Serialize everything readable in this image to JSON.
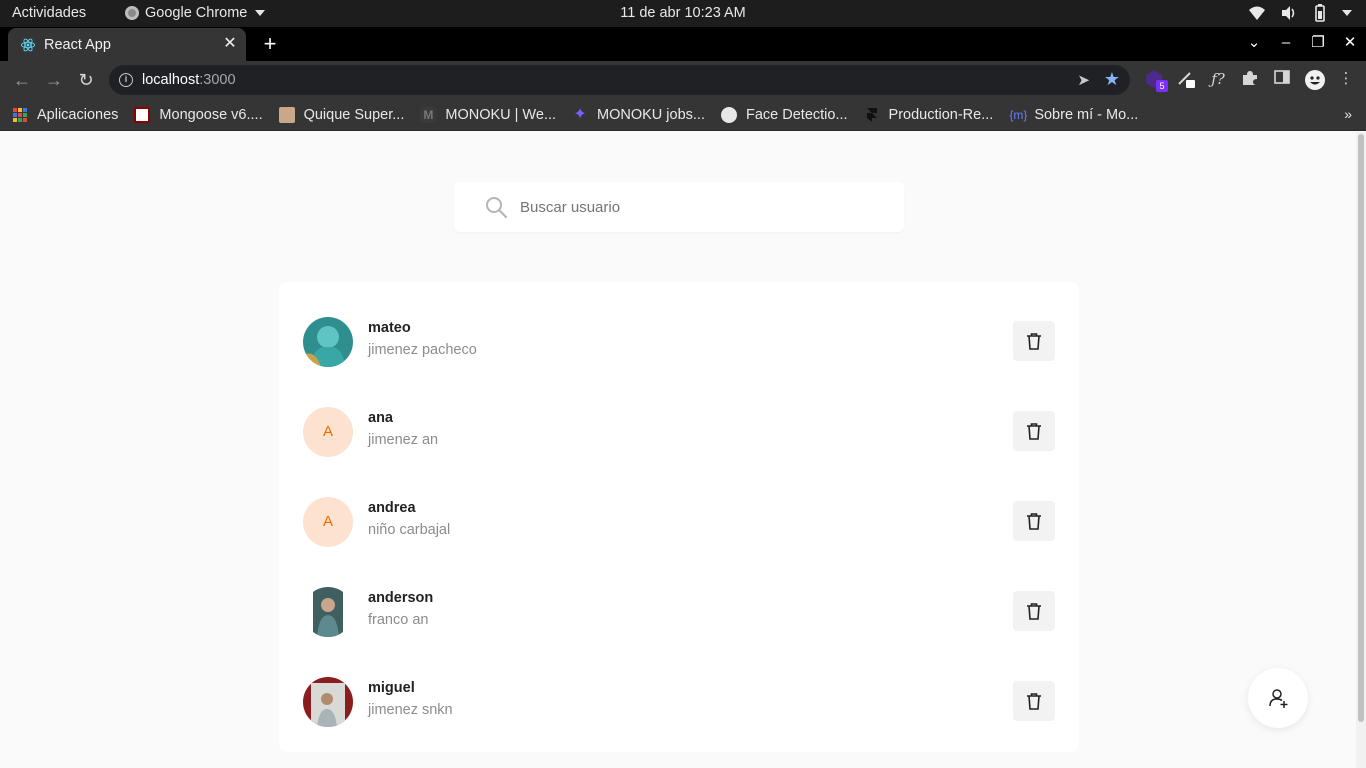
{
  "system_bar": {
    "activities": "Actividades",
    "app_name": "Google Chrome",
    "clock": "11 de abr  10:23 AM"
  },
  "browser": {
    "tab_title": "React App",
    "url_host": "localhost",
    "url_port": ":3000",
    "extension_badge": "5",
    "bookmarks": [
      {
        "label": "Aplicaciones",
        "icon": "apps-grid-icon",
        "color": "#e8453c"
      },
      {
        "label": "Mongoose v6....",
        "icon": "mongoose-icon",
        "color": "#880000"
      },
      {
        "label": "Quique Super...",
        "icon": "photo-icon",
        "color": "#c9a88a"
      },
      {
        "label": "MONOKU | We...",
        "icon": "monoku-icon",
        "color": "#555555"
      },
      {
        "label": "MONOKU jobs...",
        "icon": "sparkle-icon",
        "color": "#7c5cff"
      },
      {
        "label": "Face Detectio...",
        "icon": "globe-icon",
        "color": "#e8e8e8"
      },
      {
        "label": "Production-Re...",
        "icon": "framer-icon",
        "color": "#222222"
      },
      {
        "label": "Sobre mí - Mo...",
        "icon": "braces-icon",
        "color": "#6b7cff"
      }
    ]
  },
  "search": {
    "placeholder": "Buscar usuario",
    "value": ""
  },
  "users": [
    {
      "name": "mateo",
      "lastname": "jimenez pacheco",
      "avatar": "photo",
      "avatar_letter": ""
    },
    {
      "name": "ana",
      "lastname": "jimenez an",
      "avatar": "letter",
      "avatar_letter": "A"
    },
    {
      "name": "andrea",
      "lastname": "niño carbajal",
      "avatar": "letter",
      "avatar_letter": "A"
    },
    {
      "name": "anderson",
      "lastname": "franco an",
      "avatar": "photo",
      "avatar_letter": ""
    },
    {
      "name": "miguel",
      "lastname": "jimenez snkn",
      "avatar": "photo",
      "avatar_letter": ""
    }
  ],
  "colors": {
    "avatar_letter_bg": "#fde3cf",
    "avatar_letter_fg": "#f56a00",
    "bookmark_star": "#8ab4f8"
  }
}
